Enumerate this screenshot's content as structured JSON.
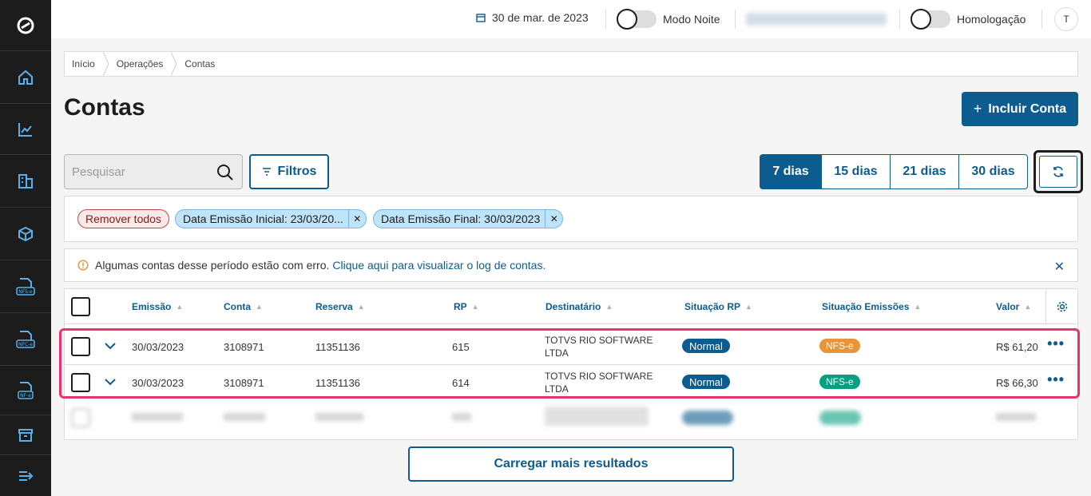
{
  "topbar": {
    "date": "30 de mar. de 2023",
    "night_mode_label": "Modo Noite",
    "homologation_label": "Homologação",
    "avatar_initial": "T"
  },
  "breadcrumb": [
    "Início",
    "Operações",
    "Contas"
  ],
  "page": {
    "title": "Contas",
    "add_button": "Incluir Conta"
  },
  "search": {
    "placeholder": "Pesquisar"
  },
  "filters_button": "Filtros",
  "period_options": [
    "7 dias",
    "15 dias",
    "21 dias",
    "30 dias"
  ],
  "active_period": "7 dias",
  "chips": {
    "remove_all": "Remover todos",
    "items": [
      "Data Emissão Inicial: 23/03/20...",
      "Data Emissão Final: 30/03/2023"
    ]
  },
  "alert": {
    "message": "Algumas contas desse período estão com erro.",
    "link": "Clique aqui para visualizar o log de contas."
  },
  "table": {
    "columns": [
      "Emissão",
      "Conta",
      "Reserva",
      "RP",
      "Destinatário",
      "Situação RP",
      "Situação Emissões",
      "Valor"
    ],
    "rows": [
      {
        "emissao": "30/03/2023",
        "conta": "3108971",
        "reserva": "11351136",
        "rp": "615",
        "dest1": "TOTVS RIO SOFTWARE",
        "dest2": "LTDA",
        "situacao_rp": "Normal",
        "situacao_emissoes": "NFS-e",
        "emissoes_color": "#e8953a",
        "valor": "R$ 61,20"
      },
      {
        "emissao": "30/03/2023",
        "conta": "3108971",
        "reserva": "11351136",
        "rp": "614",
        "dest1": "TOTVS RIO SOFTWARE",
        "dest2": "LTDA",
        "situacao_rp": "Normal",
        "situacao_emissoes": "NFS-e",
        "emissoes_color": "#0a9e80",
        "valor": "R$ 66,30"
      }
    ]
  },
  "load_more": "Carregar mais resultados",
  "colors": {
    "primary": "#0c5c8f",
    "sidebar": "#1c1c1c",
    "highlight": "#e8336b"
  }
}
